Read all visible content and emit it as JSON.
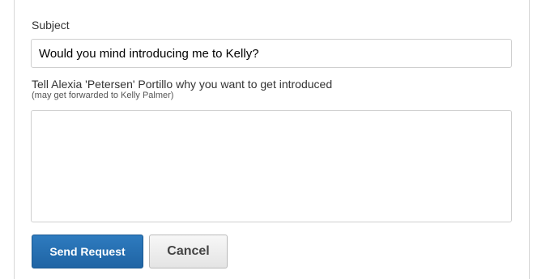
{
  "form": {
    "subject_label": "Subject",
    "subject_value": "Would you mind introducing me to Kelly?",
    "reason_label": "Tell Alexia 'Petersen' Portillo why you want to get introduced",
    "reason_sublabel": "(may get forwarded to Kelly Palmer)",
    "reason_value": ""
  },
  "buttons": {
    "send_label": "Send Request",
    "cancel_label": "Cancel"
  },
  "colors": {
    "primary_button": "#2a73b5",
    "secondary_button": "#eeeeee",
    "border": "#cfcfcf"
  }
}
